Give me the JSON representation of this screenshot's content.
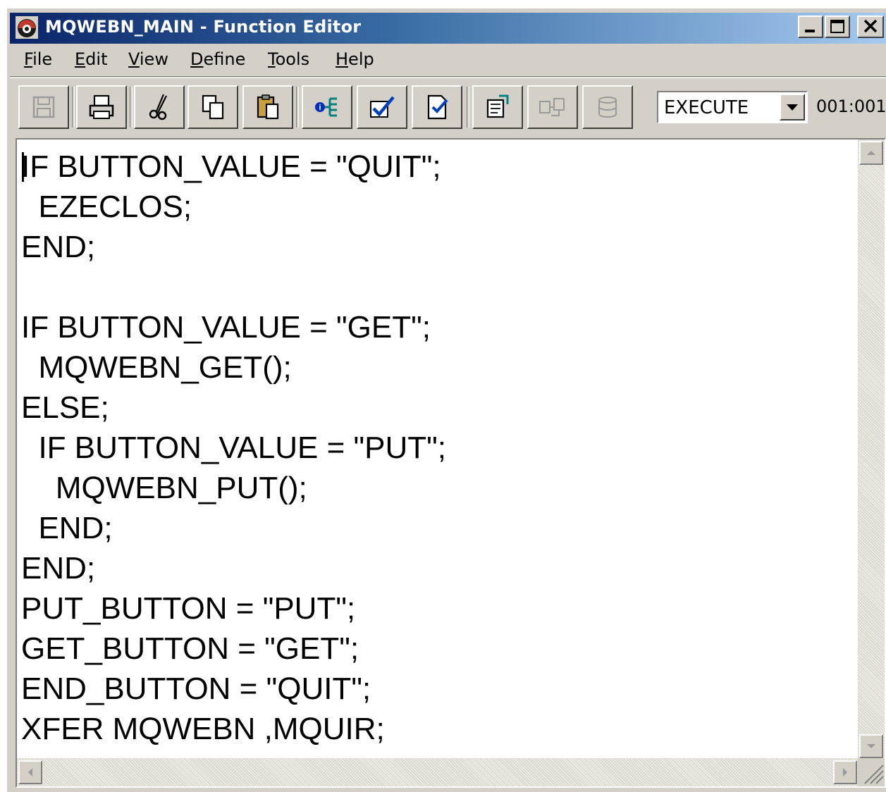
{
  "window": {
    "title": "MQWEBN_MAIN - Function Editor",
    "app_icon": "app-icon",
    "controls": {
      "minimize_icon": "minimize-icon",
      "maximize_icon": "maximize-icon",
      "close_icon": "close-icon"
    }
  },
  "menubar": {
    "items": [
      {
        "accel": "F",
        "rest": "ile"
      },
      {
        "accel": "E",
        "rest": "dit"
      },
      {
        "accel": "V",
        "rest": "iew"
      },
      {
        "accel": "D",
        "rest": "efine"
      },
      {
        "accel": "T",
        "rest": "ools"
      },
      {
        "accel": "H",
        "rest": "elp"
      }
    ]
  },
  "toolbar": {
    "buttons": [
      {
        "icon": "save-icon",
        "enabled": false
      },
      {
        "icon": "print-icon",
        "enabled": true
      },
      {
        "icon": "cut-icon",
        "enabled": true
      },
      {
        "icon": "copy-icon",
        "enabled": true
      },
      {
        "icon": "paste-icon",
        "enabled": true
      },
      {
        "icon": "info-icon",
        "enabled": true
      },
      {
        "icon": "check-icon",
        "enabled": true
      },
      {
        "icon": "check-document-icon",
        "enabled": true
      },
      {
        "icon": "properties-icon",
        "enabled": true
      },
      {
        "icon": "transfer-icon",
        "enabled": false
      },
      {
        "icon": "database-icon",
        "enabled": false
      }
    ],
    "dropdown_value": "EXECUTE",
    "dropdown_icon": "chevron-down-icon",
    "cursor_position": "001:001"
  },
  "editor": {
    "lines": [
      "IF BUTTON_VALUE = \"QUIT\";",
      "  EZECLOS;",
      "END;",
      "",
      "IF BUTTON_VALUE = \"GET\";",
      "  MQWEBN_GET();",
      "ELSE;",
      "  IF BUTTON_VALUE = \"PUT\";",
      "    MQWEBN_PUT();",
      "  END;",
      "END;",
      "PUT_BUTTON = \"PUT\";",
      "GET_BUTTON = \"GET\";",
      "END_BUTTON = \"QUIT\";",
      "XFER MQWEBN ,MQUIR;"
    ]
  },
  "colors": {
    "title_gradient_start": "#0a246a",
    "title_gradient_end": "#a6caf0",
    "face": "#d4d0c8",
    "disabled_icon": "#9a9a9a"
  }
}
